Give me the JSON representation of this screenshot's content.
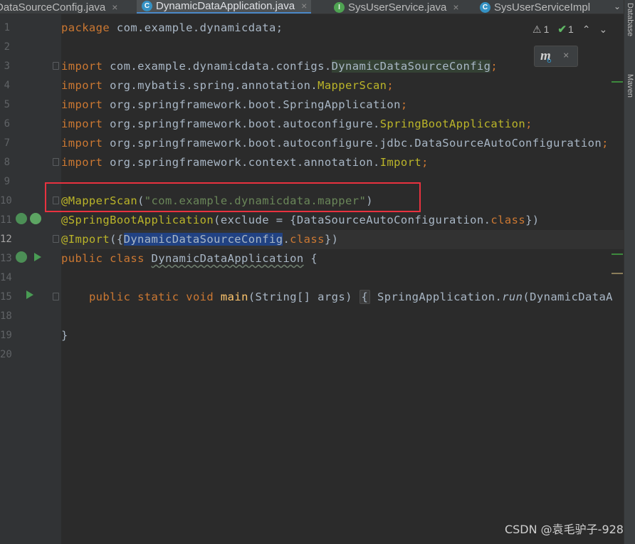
{
  "tabs": [
    {
      "label": "DataSourceConfig.java",
      "icon": "class-icon",
      "close": "×",
      "active": false
    },
    {
      "label": "DynamicDataApplication.java",
      "icon": "class-icon",
      "close": "×",
      "active": true
    },
    {
      "label": "SysUserService.java",
      "icon": "interface-icon",
      "close": "×",
      "active": false
    },
    {
      "label": "SysUserServiceImpl",
      "icon": "class-icon",
      "close": "",
      "active": false
    }
  ],
  "tab_icon_letters": {
    "class": "C",
    "interface": "I"
  },
  "tab_overflow": "⌄",
  "tool_windows": {
    "database": "Database",
    "maven": "Maven"
  },
  "inspections": {
    "warnings": "1",
    "weak_warnings": "1",
    "warn_glyph": "⚠",
    "ok_glyph": "✔",
    "up": "⌃",
    "down": "⌄"
  },
  "maven_popup": {
    "logo": "m",
    "sync_glyph": "↻",
    "close": "×"
  },
  "line_numbers": [
    "1",
    "2",
    "3",
    "4",
    "5",
    "6",
    "7",
    "8",
    "9",
    "10",
    "11",
    "12",
    "13",
    "14",
    "15",
    "18",
    "19",
    "20"
  ],
  "code": {
    "l1": {
      "kw": "package",
      "rest": " com.example.dynamicdata;"
    },
    "l3": {
      "kw": "import",
      "pkg": " com.example.dynamicdata.configs.",
      "cls": "DynamicDataSourceConfig",
      "end": ";"
    },
    "l4": {
      "kw": "import",
      "pkg": " org.mybatis.spring.annotation.",
      "cls": "MapperScan",
      "end": ";"
    },
    "l5": {
      "kw": "import",
      "pkg": " org.springframework.boot.SpringApplication",
      "end": ";"
    },
    "l6": {
      "kw": "import",
      "pkg": " org.springframework.boot.autoconfigure.",
      "cls": "SpringBootApplication",
      "end": ";"
    },
    "l7": {
      "kw": "import",
      "pkg": " org.springframework.boot.autoconfigure.jdbc.DataSourceAutoConfiguration",
      "end": ";"
    },
    "l8": {
      "kw": "import",
      "pkg": " org.springframework.context.annotation.",
      "cls": "Import",
      "end": ";"
    },
    "l10": {
      "ann": "@MapperScan",
      "open": "(",
      "str": "\"com.example.dynamicdata.mapper\"",
      "close": ")"
    },
    "l11": {
      "ann": "@SpringBootApplication",
      "mid": "(exclude = {DataSourceAutoConfiguration.",
      "kw": "class",
      "end": "})"
    },
    "l12": {
      "ann": "@Import",
      "open": "({",
      "sel": "DynamicDataSourceConfig",
      "dot": ".",
      "kw": "class",
      "end": "})"
    },
    "l13": {
      "kw1": "public",
      "kw2": "class",
      "name": "DynamicDataApplication",
      "end": " {"
    },
    "l15": {
      "indent": "    ",
      "kw1": "public",
      "kw2": "static",
      "kw3": "void",
      "fn": "main",
      "params": "(String[] args) ",
      "brace": "{",
      "call1": " SpringApplication.",
      "run": "run",
      "call2": "(DynamicDataA"
    },
    "l19": {
      "text": "}"
    }
  },
  "watermark": "CSDN @袁毛驴子-928",
  "colors": {
    "keyword": "#cc7832",
    "annotation": "#bbb529",
    "string": "#6a8759",
    "function": "#ffc66d",
    "red_box": "#e8323f",
    "selection": "#214283"
  }
}
